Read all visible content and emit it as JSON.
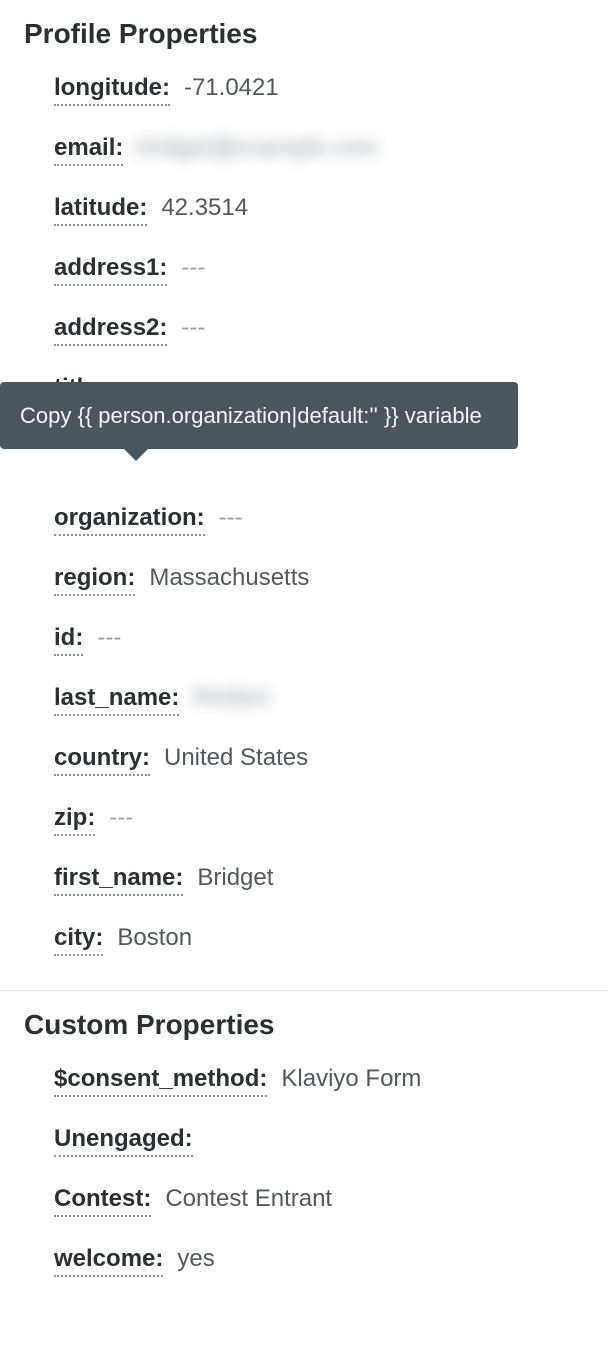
{
  "sections": {
    "profile": {
      "title": "Profile Properties",
      "items": [
        {
          "label": "longitude:",
          "value": "-71.0421",
          "type": "text"
        },
        {
          "label": "email:",
          "value": "bridget@example.com",
          "type": "blurred"
        },
        {
          "label": "latitude:",
          "value": "42.3514",
          "type": "text"
        },
        {
          "label": "address1:",
          "value": "---",
          "type": "empty"
        },
        {
          "label": "address2:",
          "value": "---",
          "type": "empty"
        },
        {
          "label": "title:",
          "value": "---",
          "type": "empty"
        },
        {
          "label": "organization:",
          "value": "---",
          "type": "empty",
          "tooltip": "Copy {{ person.organization|default:'' }} variable"
        },
        {
          "label": "region:",
          "value": "Massachusetts",
          "type": "text"
        },
        {
          "label": "id:",
          "value": "---",
          "type": "empty"
        },
        {
          "label": "last_name:",
          "value": "Redact",
          "type": "blurred"
        },
        {
          "label": "country:",
          "value": "United States",
          "type": "text"
        },
        {
          "label": "zip:",
          "value": "---",
          "type": "empty"
        },
        {
          "label": "first_name:",
          "value": "Bridget",
          "type": "text"
        },
        {
          "label": "city:",
          "value": "Boston",
          "type": "text"
        }
      ]
    },
    "custom": {
      "title": "Custom Properties",
      "items": [
        {
          "label": "$consent_method:",
          "value": "Klaviyo Form",
          "type": "text"
        },
        {
          "label": "Unengaged:",
          "value": "",
          "type": "none"
        },
        {
          "label": "Contest:",
          "value": "Contest Entrant",
          "type": "text"
        },
        {
          "label": "welcome:",
          "value": "yes",
          "type": "text"
        }
      ]
    }
  },
  "tooltip_text": "Copy {{ person.organization|default:'' }} variable"
}
